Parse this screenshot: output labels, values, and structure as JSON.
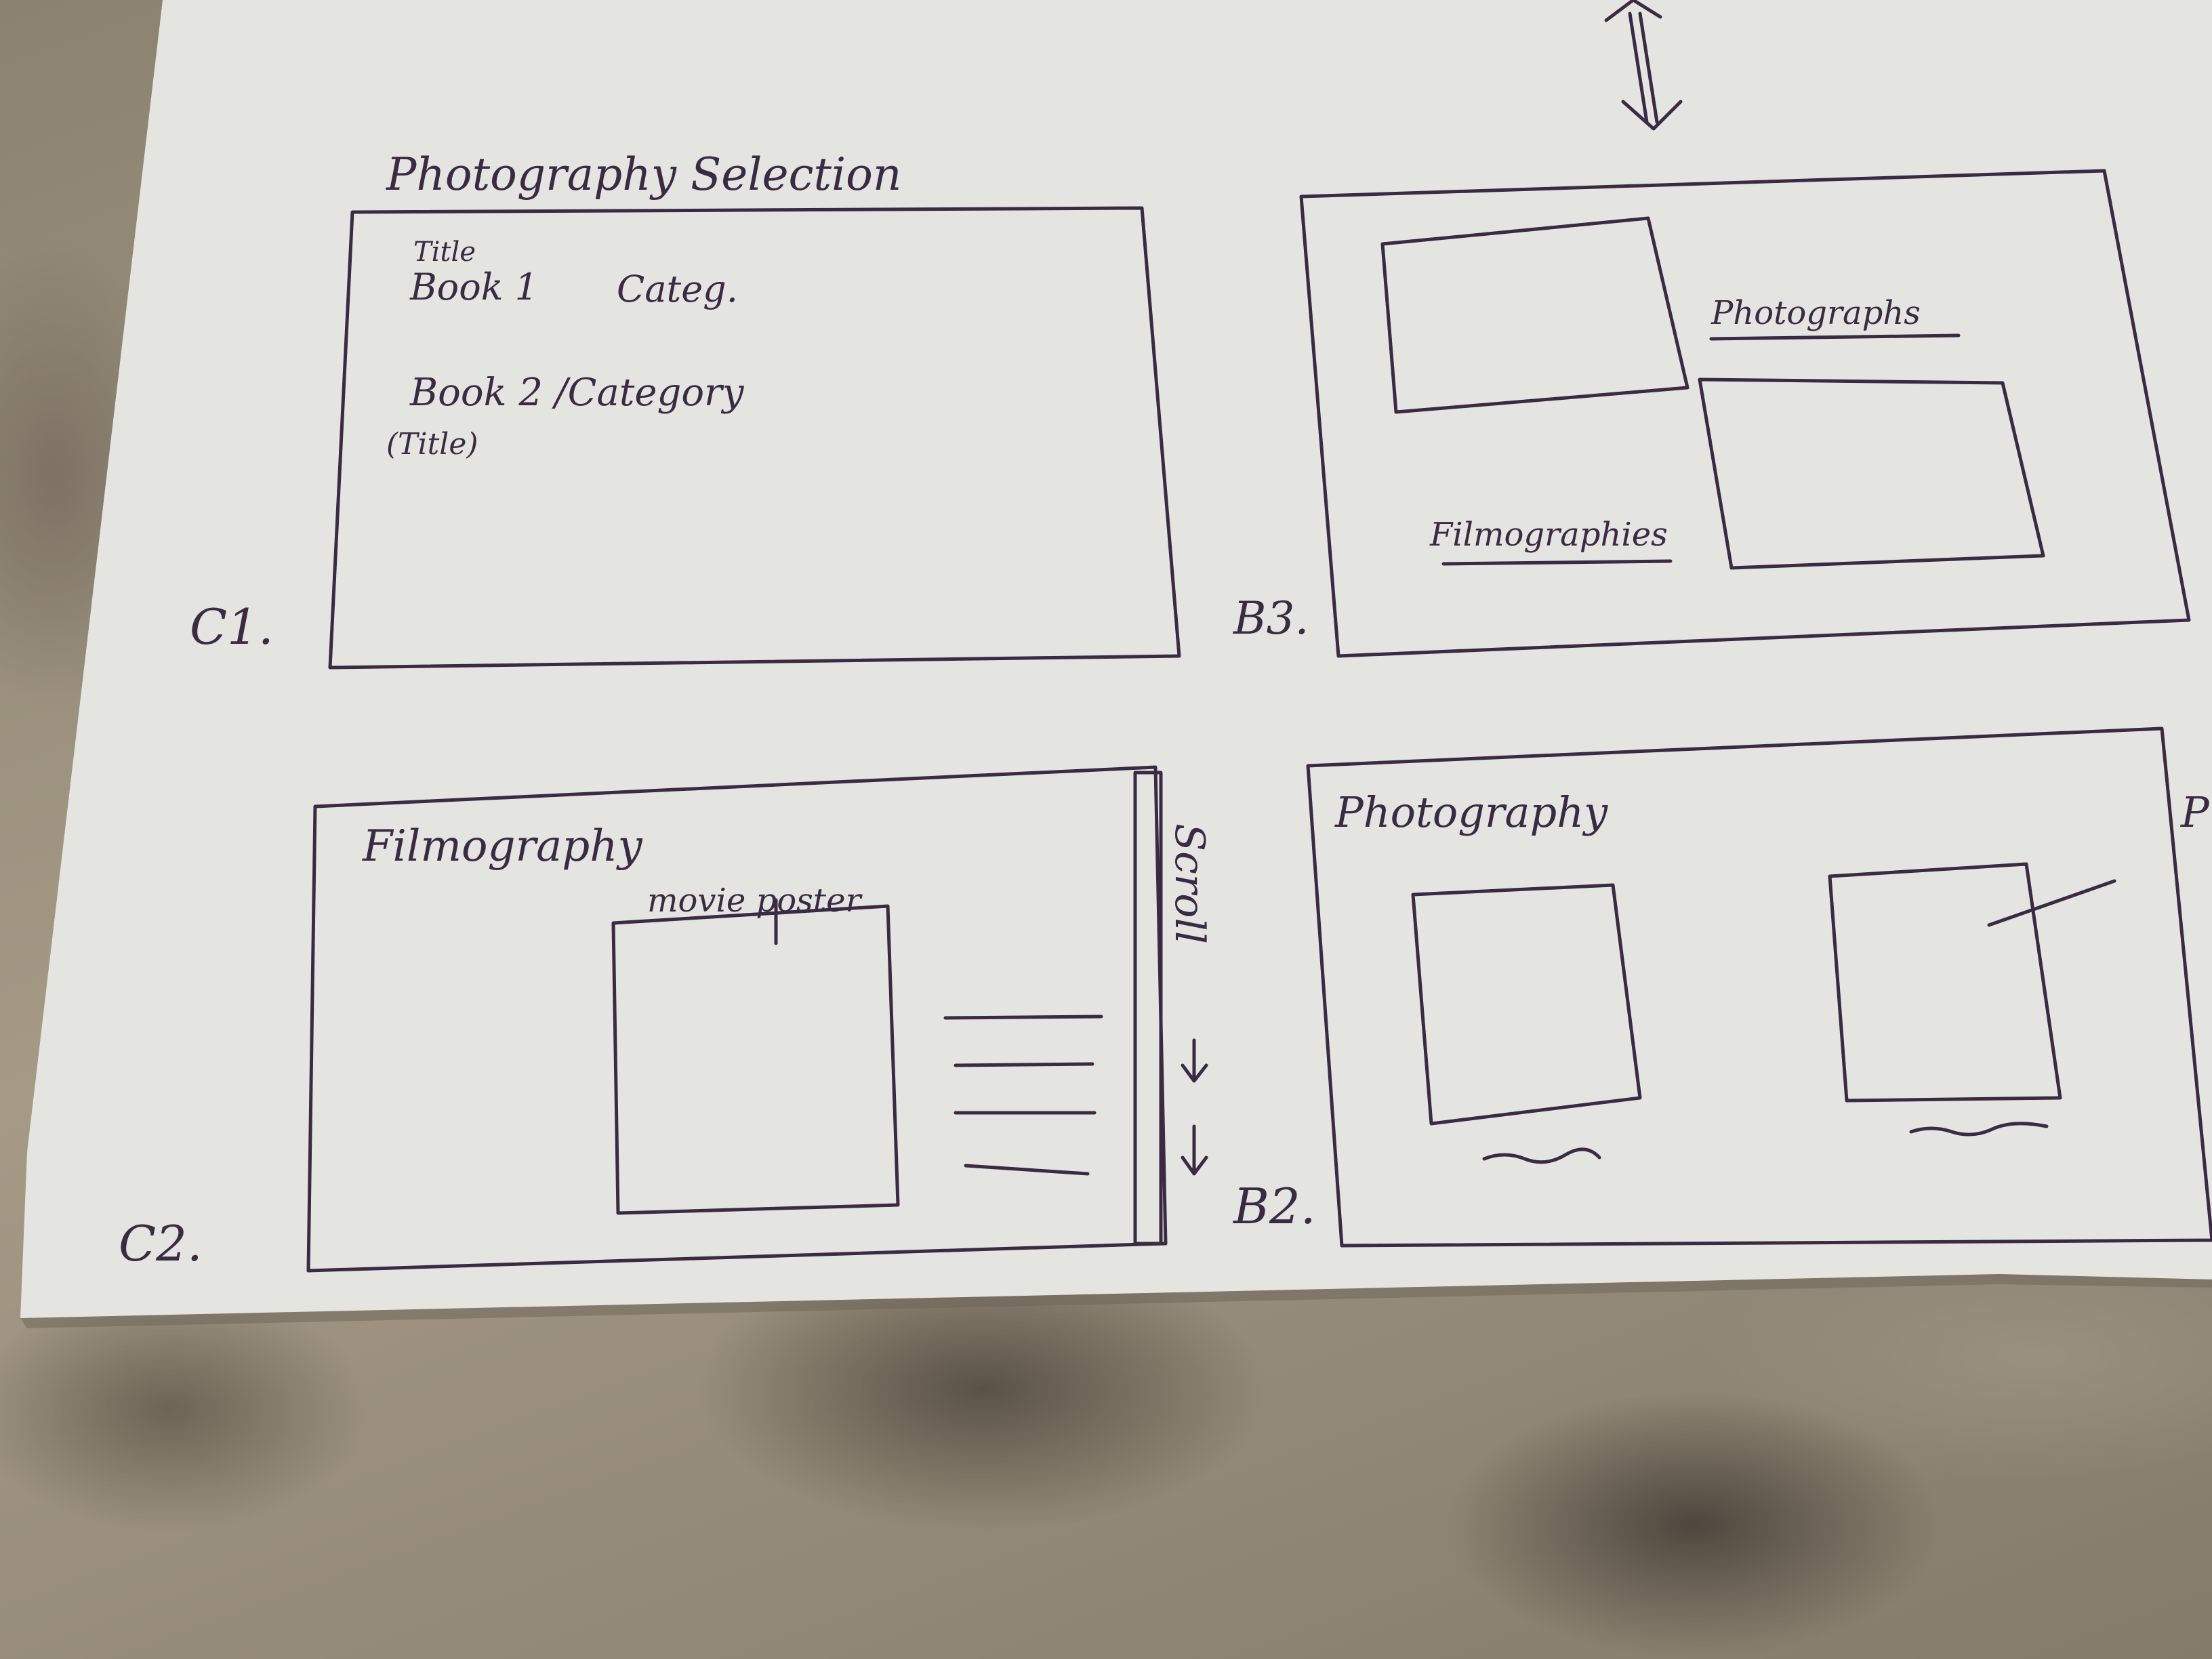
{
  "colors": {
    "paper": "#e4e4e1",
    "ink": "#3a2a44",
    "fabric_light": "#a49a86",
    "fabric_dark": "#5b5247"
  },
  "sketch": {
    "c1": {
      "heading": "Photography Selection",
      "label": "C1.",
      "title_note": "Title",
      "book1": "Book 1",
      "book1_category": "Categ.",
      "book2": "Book 2 /Category",
      "title_paren": "(Title)"
    },
    "b3": {
      "label": "B3.",
      "photographs": "Photographs",
      "filmographies": "Filmographies"
    },
    "c2": {
      "label": "C2.",
      "heading": "Filmography",
      "poster_label": "movie poster",
      "scroll_note": "Scroll"
    },
    "b2": {
      "label": "B2.",
      "heading": "Photography",
      "edge_text": "P"
    }
  }
}
